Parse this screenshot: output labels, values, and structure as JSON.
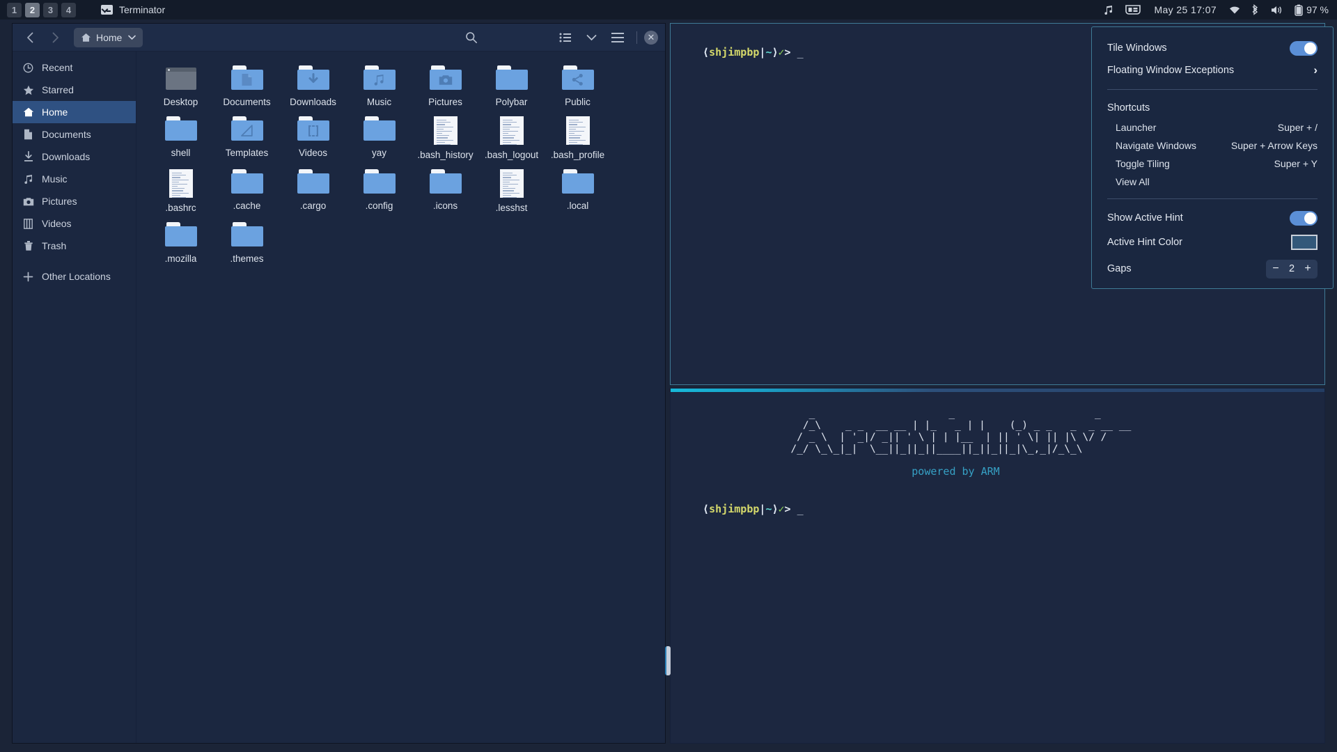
{
  "topbar": {
    "workspaces": [
      {
        "label": "1",
        "active": false
      },
      {
        "label": "2",
        "active": true
      },
      {
        "label": "3",
        "active": false
      },
      {
        "label": "4",
        "active": false
      }
    ],
    "window_title": "Terminator",
    "tray": {
      "music_icon": "music-note-icon",
      "layout_icon": "window-layout-icon",
      "clock": "May 25  17:07",
      "wifi_icon": "wifi-icon",
      "bluetooth_icon": "bluetooth-icon",
      "volume_icon": "volume-icon",
      "battery_icon": "battery-icon",
      "battery_label": "97 %"
    }
  },
  "filemanager": {
    "back_label": "‹",
    "forward_label": "›",
    "breadcrumb_label": "Home",
    "breadcrumb_chevron": "∨",
    "tools": {
      "search": "search-icon",
      "view_list": "list-view-icon",
      "view_chevron": "∨",
      "menu": "hamburger-menu-icon",
      "close": "✕"
    },
    "sidebar": [
      {
        "label": "Recent",
        "icon": "clock-icon",
        "selected": false
      },
      {
        "label": "Starred",
        "icon": "star-icon",
        "selected": false
      },
      {
        "label": "Home",
        "icon": "home-icon",
        "selected": true
      },
      {
        "label": "Documents",
        "icon": "document-icon",
        "selected": false
      },
      {
        "label": "Downloads",
        "icon": "download-icon",
        "selected": false
      },
      {
        "label": "Music",
        "icon": "music-note-icon",
        "selected": false
      },
      {
        "label": "Pictures",
        "icon": "camera-icon",
        "selected": false
      },
      {
        "label": "Videos",
        "icon": "film-icon",
        "selected": false
      },
      {
        "label": "Trash",
        "icon": "trash-icon",
        "selected": false
      },
      {
        "label": "Other Locations",
        "icon": "plus-icon",
        "selected": false
      }
    ],
    "files": [
      {
        "name": "Desktop",
        "kind": "window"
      },
      {
        "name": "Documents",
        "kind": "folder",
        "glyph": "document"
      },
      {
        "name": "Downloads",
        "kind": "folder",
        "glyph": "download"
      },
      {
        "name": "Music",
        "kind": "folder",
        "glyph": "music"
      },
      {
        "name": "Pictures",
        "kind": "folder",
        "glyph": "camera"
      },
      {
        "name": "Polybar",
        "kind": "folder",
        "glyph": "none"
      },
      {
        "name": "Public",
        "kind": "folder",
        "glyph": "share"
      },
      {
        "name": "shell",
        "kind": "folder",
        "glyph": "none"
      },
      {
        "name": "Templates",
        "kind": "folder",
        "glyph": "ruler"
      },
      {
        "name": "Videos",
        "kind": "folder",
        "glyph": "film"
      },
      {
        "name": "yay",
        "kind": "folder",
        "glyph": "none"
      },
      {
        "name": ".bash_history",
        "kind": "text"
      },
      {
        "name": ".bash_logout",
        "kind": "text"
      },
      {
        "name": ".bash_profile",
        "kind": "text"
      },
      {
        "name": ".bashrc",
        "kind": "text"
      },
      {
        "name": ".cache",
        "kind": "folder",
        "glyph": "none"
      },
      {
        "name": ".cargo",
        "kind": "folder",
        "glyph": "none"
      },
      {
        "name": ".config",
        "kind": "folder",
        "glyph": "none"
      },
      {
        "name": ".icons",
        "kind": "folder",
        "glyph": "none"
      },
      {
        "name": ".lesshst",
        "kind": "text"
      },
      {
        "name": ".local",
        "kind": "folder",
        "glyph": "none"
      },
      {
        "name": ".mozilla",
        "kind": "folder",
        "glyph": "none"
      },
      {
        "name": ".themes",
        "kind": "folder",
        "glyph": "none"
      }
    ]
  },
  "terminal": {
    "prompt_open": "⟨",
    "prompt_user": "shjimpbp",
    "prompt_pipe": "|",
    "prompt_path": "~",
    "prompt_close": "⟩",
    "prompt_ok": "✓",
    "prompt_arrow": ">",
    "cursor": "_",
    "ascii_art": "    _         _            _             _       _              ___       _           _       _  __ _   _ __  __\n   /_\\  _ _ __| |_    | |    (_) _ _  _  _ \\_/\n  / _ \\| '_/ _| ' \\   | |__  | || \\ \\/ /\n /_/ \\_\\_| \\__|_||_|  |____| |_||_|_/\\_\\",
    "ascii_lines": [
      "     _                      _                       _       ",
      "    /_\\    _ _  __ __ | |_   _ | |    (_) _ _   _  _ __ __ ",
      "   / _ \\  | '_|/ _|| ' \\ | | |__  | || ' \\| || |\\ \\/ /",
      "  /_/ \\_\\_|_|  \\__||_||_||____||_||_||_|\\_,_|/_\\_\\"
    ],
    "powered_by": "powered by ARM"
  },
  "tiling_panel": {
    "tile_windows_label": "Tile Windows",
    "tile_windows_on": true,
    "floating_exceptions_label": "Floating Window Exceptions",
    "floating_exceptions_chevron": "›",
    "shortcuts_header": "Shortcuts",
    "shortcuts": [
      {
        "label": "Launcher",
        "keys": "Super + /"
      },
      {
        "label": "Navigate Windows",
        "keys": "Super + Arrow Keys"
      },
      {
        "label": "Toggle Tiling",
        "keys": "Super + Y"
      },
      {
        "label": "View All",
        "keys": ""
      }
    ],
    "show_active_hint_label": "Show Active Hint",
    "show_active_hint_on": true,
    "active_hint_color_label": "Active Hint Color",
    "active_hint_color": "#33587a",
    "gaps_label": "Gaps",
    "gaps_minus": "−",
    "gaps_value": "2",
    "gaps_plus": "+"
  },
  "colors": {
    "accent_blue": "#5b8fd6",
    "desktop_bg": "#1b2437",
    "panel_bg": "#1a2740",
    "active_border": "#3f7b96",
    "folder_blue": "#6ba2e0",
    "prompt_user": "#d5d96b",
    "prompt_path": "#5fd7d0",
    "powered_by": "#36a0c4"
  }
}
